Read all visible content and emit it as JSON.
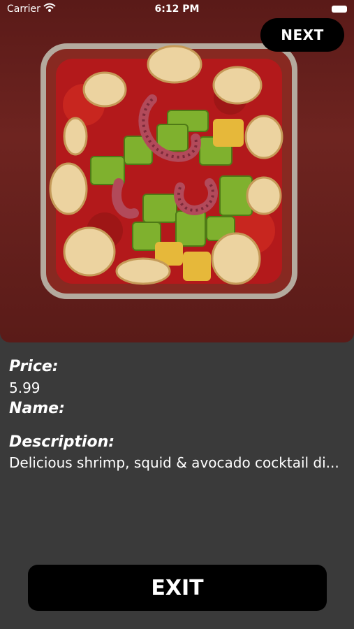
{
  "status_bar": {
    "carrier": "Carrier",
    "time": "6:12 PM"
  },
  "nav": {
    "next_label": "NEXT"
  },
  "details": {
    "price_label": "Price:",
    "price_value": "5.99",
    "name_label": "Name:",
    "name_value": "",
    "description_label": "Description:",
    "description_value": "Delicious shrimp, squid & avocado cocktail di..."
  },
  "footer": {
    "exit_label": "EXIT"
  },
  "colors": {
    "background": "#3a3a3a",
    "button": "#000000",
    "text": "#ffffff"
  }
}
